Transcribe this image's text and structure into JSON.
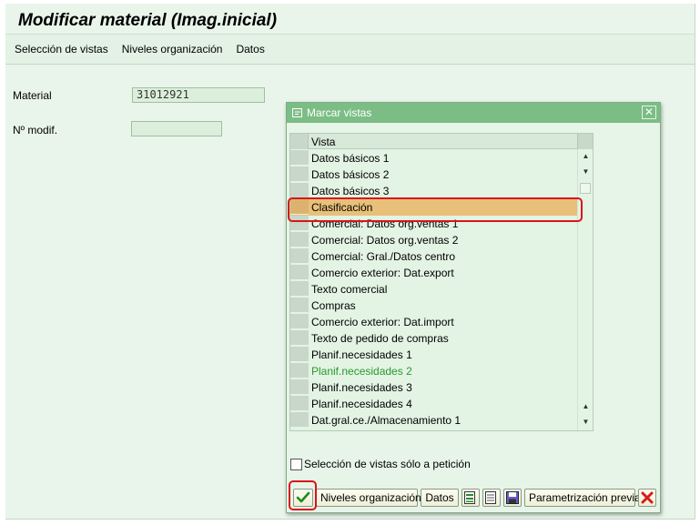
{
  "screen": {
    "title": "Modificar material (Imag.inicial)",
    "menu": [
      "Selección de vistas",
      "Niveles organización",
      "Datos"
    ],
    "material_label": "Material",
    "material_value": "31012921",
    "nmodif_label": "Nº modif.",
    "nmodif_value": ""
  },
  "dialog": {
    "title": "Marcar vistas",
    "column_header": "Vista",
    "rows": [
      {
        "label": "Datos básicos 1"
      },
      {
        "label": "Datos básicos 2"
      },
      {
        "label": "Datos básicos 3"
      },
      {
        "label": "Clasificación",
        "state": "highlighted"
      },
      {
        "label": "Comercial: Datos org.ventas 1"
      },
      {
        "label": "Comercial: Datos org.ventas 2"
      },
      {
        "label": "Comercial: Gral./Datos centro"
      },
      {
        "label": "Comercio exterior: Dat.export"
      },
      {
        "label": "Texto comercial"
      },
      {
        "label": "Compras"
      },
      {
        "label": "Comercio exterior: Dat.import"
      },
      {
        "label": "Texto de pedido de compras"
      },
      {
        "label": "Planif.necesidades 1"
      },
      {
        "label": "Planif.necesidades 2",
        "state": "green"
      },
      {
        "label": "Planif.necesidades 3"
      },
      {
        "label": "Planif.necesidades 4"
      },
      {
        "label": "Dat.gral.ce./Almacenamiento 1"
      }
    ],
    "checkbox_label": "Selección de vistas sólo a petición",
    "checkbox_checked": false,
    "buttons": {
      "confirm_icon": "checkmark-icon",
      "org_levels": "Niveles organización",
      "data": "Datos",
      "select_all_icon": "select-all-icon",
      "deselect_all_icon": "deselect-all-icon",
      "save_icon": "save-icon",
      "params": "Parametrización previa",
      "cancel_icon": "cancel-icon"
    }
  },
  "colors": {
    "title_bar": "#7bbd85",
    "highlight": "#e8c07a",
    "green_text": "#2a9a2a",
    "annotation_red": "#d8151a"
  }
}
